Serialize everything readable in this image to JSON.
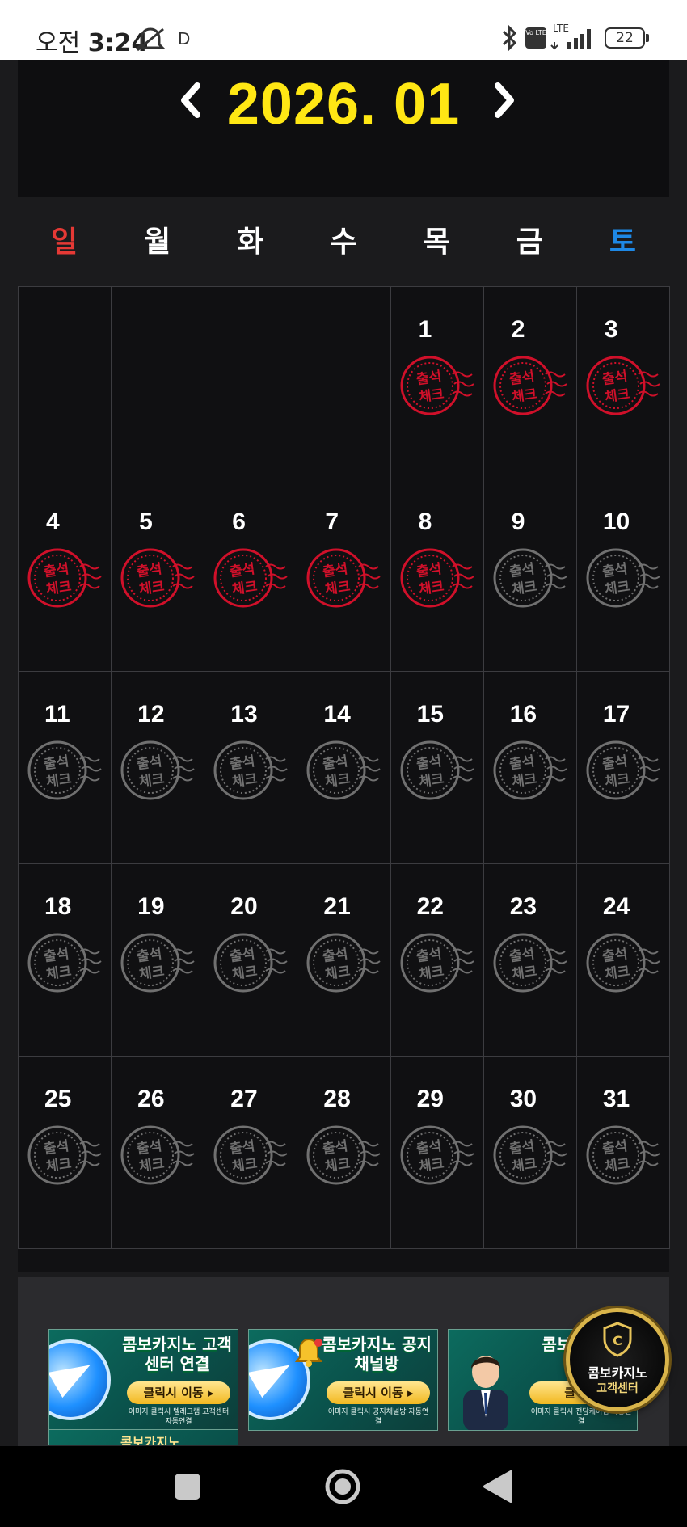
{
  "status_bar": {
    "time_prefix": "오전",
    "time": "3:24",
    "carrier_letter": "D",
    "network": "LTE",
    "volte": "Vo LTE",
    "battery": "22"
  },
  "calendar": {
    "month_title": "2026. 01",
    "weekdays": [
      "일",
      "월",
      "화",
      "수",
      "목",
      "금",
      "토"
    ],
    "weekday_colors": [
      "#e53935",
      "#ffffff",
      "#ffffff",
      "#ffffff",
      "#ffffff",
      "#ffffff",
      "#1e88e5"
    ],
    "stamp_text": [
      "출석",
      "체크"
    ],
    "days": [
      "",
      "",
      "",
      "",
      "1",
      "2",
      "3",
      "4",
      "5",
      "6",
      "7",
      "8",
      "9",
      "10",
      "11",
      "12",
      "13",
      "14",
      "15",
      "16",
      "17",
      "18",
      "19",
      "20",
      "21",
      "22",
      "23",
      "24",
      "25",
      "26",
      "27",
      "28",
      "29",
      "30",
      "31"
    ],
    "checked_days": [
      1,
      2,
      3,
      4,
      5,
      6,
      7,
      8
    ],
    "checked_color": "#d0102a",
    "unchecked_color": "#707070"
  },
  "banners": [
    {
      "title": "콤보카지노 고객센터 연결",
      "button": "클릭시 이동 ▸",
      "sub": "이미지 클릭시 텔레그램 고객센터 자동연결",
      "icon": "telegram-plane-icon"
    },
    {
      "title": "콤보카지노 공지 채널방",
      "button": "클릭시 이동 ▸",
      "sub": "이미지 클릭시 공지채널방 자동연결",
      "icon": "bell-icon"
    },
    {
      "title": "콤보 1:1 전",
      "button": "클릭시",
      "sub": "이미지 클릭시 전담케어팀 자동연결",
      "icon": "agent-person-icon"
    }
  ],
  "floating_badge": {
    "line1": "콤보카지노",
    "line2": "고객센터"
  },
  "peek_banner": {
    "text": "콤보카지노"
  }
}
